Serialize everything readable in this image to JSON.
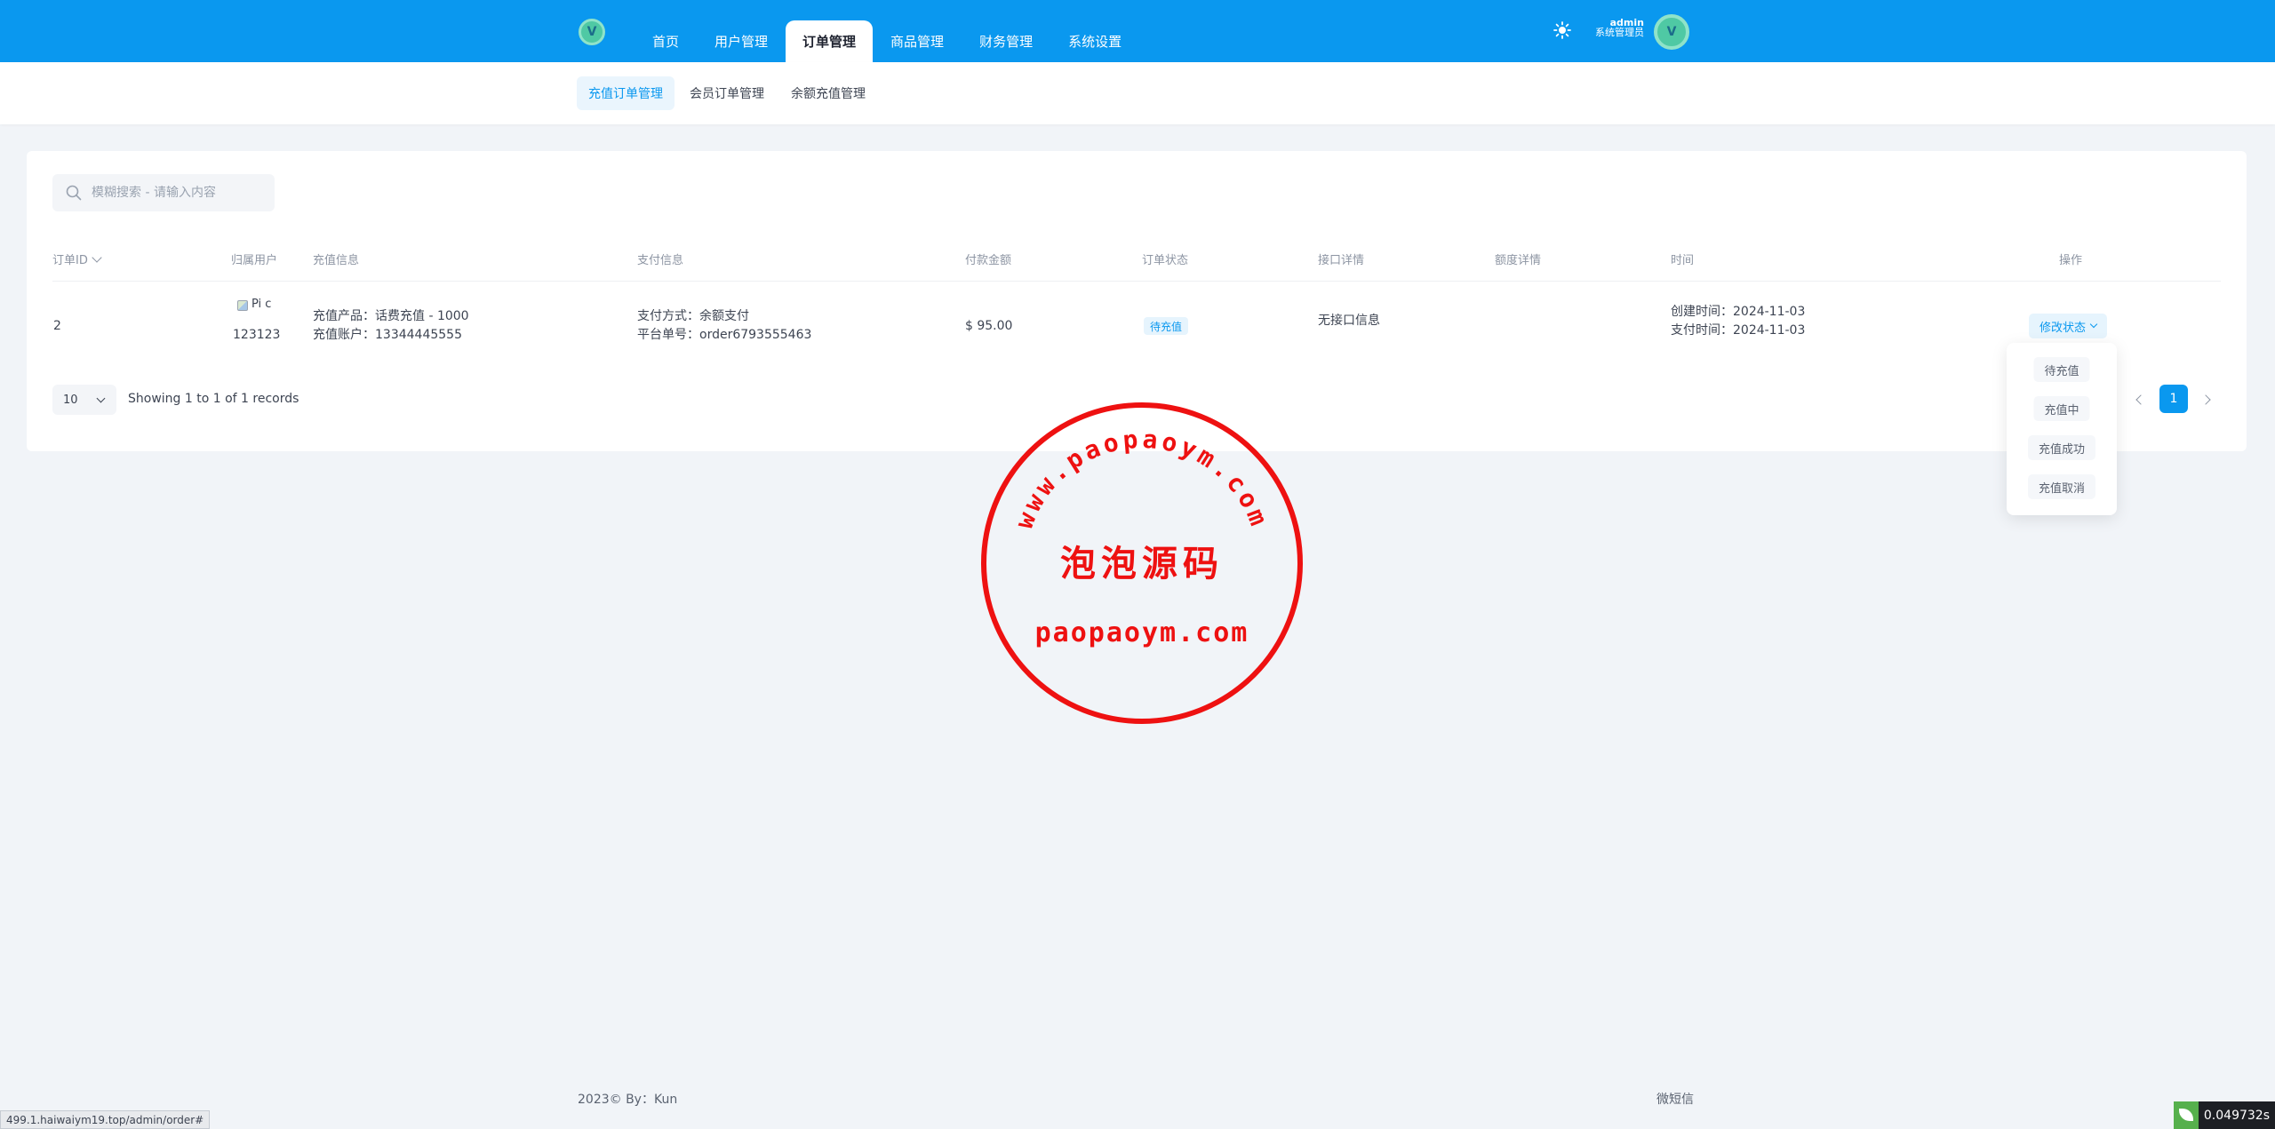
{
  "topbar": {
    "logo_text": "V",
    "nav": [
      "首页",
      "用户管理",
      "订单管理",
      "商品管理",
      "财务管理",
      "系统设置"
    ],
    "active_nav_index": 2,
    "user": {
      "name": "admin",
      "role": "系统管理员",
      "avatar_text": "V"
    },
    "bg_color": "#0a98ef"
  },
  "subnav": {
    "tabs": [
      "充值订单管理",
      "会员订单管理",
      "余额充值管理"
    ],
    "active_index": 0
  },
  "search": {
    "placeholder": "模糊搜索 - 请输入内容",
    "value": ""
  },
  "table": {
    "columns": [
      "订单ID",
      "归属用户",
      "充值信息",
      "支付信息",
      "付款金额",
      "订单状态",
      "接口详情",
      "额度详情",
      "时间",
      "操作"
    ],
    "rows": [
      {
        "id": "2",
        "user_img_alt": "Pi c",
        "user_name": "123123",
        "recharge_product": "充值产品：话费充值 - 1000",
        "recharge_account": "充值账户：13344445555",
        "pay_method": "支付方式：余额支付",
        "platform_no": "平台单号：order6793555463",
        "amount": "$ 95.00",
        "status": "待充值",
        "interface": "无接口信息",
        "created": "创建时间：2024-11-03",
        "paid": "支付时间：2024-11-03",
        "action": "修改状态"
      }
    ]
  },
  "dropdown": {
    "items": [
      "待充值",
      "充值中",
      "充值成功",
      "充值取消"
    ]
  },
  "pagination": {
    "page_size": "10",
    "records_text": "Showing 1 to 1 of 1 records",
    "current_page": "1"
  },
  "watermark": {
    "top_text": "www.paopaoym.com",
    "center_text": "泡泡源码",
    "bottom_text": "paopaoym.com",
    "color": "#ee1111"
  },
  "footer": {
    "left": "2023© By：Kun",
    "right": "微短信"
  },
  "status_bar": {
    "url": "499.1.haiwaiym19.top/admin/order#",
    "timer": "0.049732s"
  }
}
